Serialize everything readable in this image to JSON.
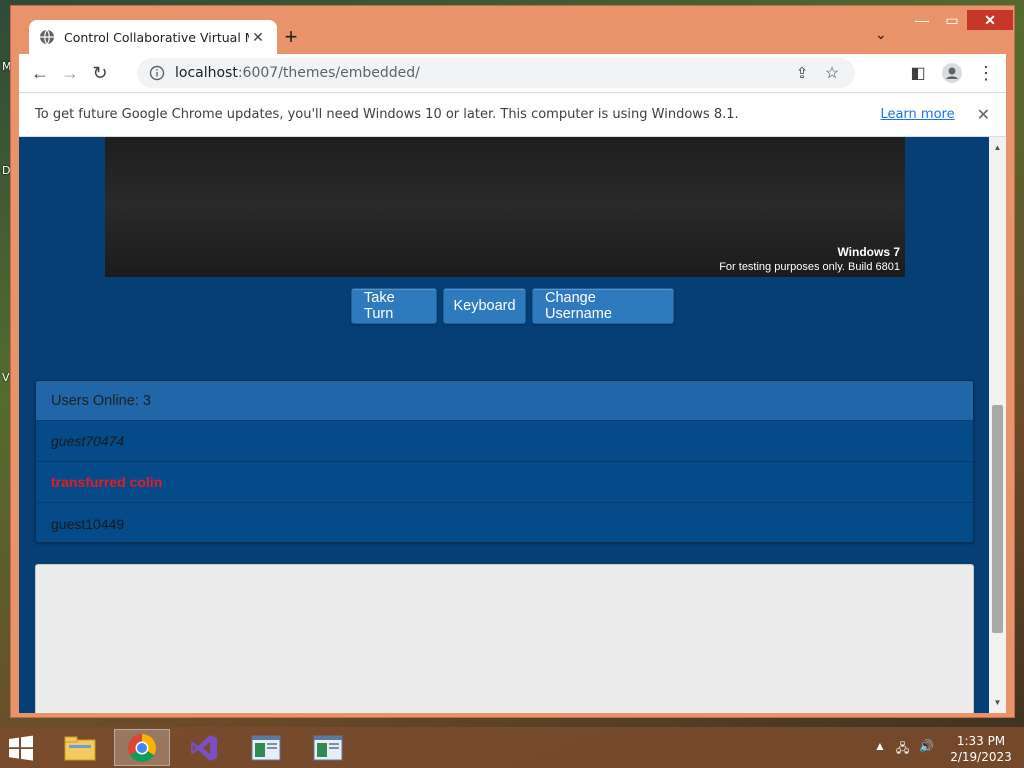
{
  "desktop": {
    "letters": [
      "M",
      "D",
      "V"
    ]
  },
  "browser": {
    "tab_title": "Control Collaborative Virtual Ma",
    "new_tab_symbol": "+",
    "url_host": "localhost",
    "url_path": ":6007/themes/embedded/",
    "infobar": {
      "message": "To get future Google Chrome updates, you'll need Windows 10 or later. This computer is using Windows 8.1.",
      "learn_more": "Learn more"
    }
  },
  "vm": {
    "watermark_title": "Windows 7",
    "watermark_sub": "For testing purposes only. Build 6801"
  },
  "buttons": {
    "take_turn": "Take Turn",
    "keyboard": "Keyboard",
    "change_username": "Change Username"
  },
  "users": {
    "header": "Users Online: 3",
    "list": [
      "guest70474",
      "transfurred colin",
      "guest10449"
    ]
  },
  "taskbar": {
    "time": "1:33 PM",
    "date": "2/19/2023"
  },
  "colors": {
    "page_bg": "#053f75",
    "button_bg": "#2f79bd",
    "highlight_user": "#e51b23"
  }
}
